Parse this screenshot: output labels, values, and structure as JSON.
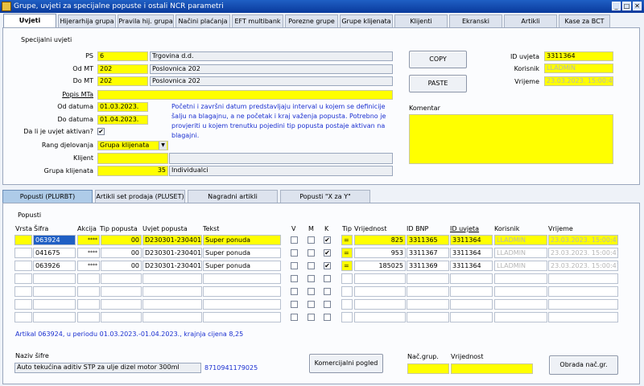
{
  "window": {
    "title": "Grupe, uvjeti za specijalne popuste i ostali NCR parametri"
  },
  "tabs": [
    "Uvjeti",
    "Hijerarhija grupa",
    "Pravila hij. grupa",
    "Načini plaćanja",
    "EFT multibank",
    "Porezne grupe",
    "Grupe klijenata",
    "Klijenti",
    "Ekranski",
    "Artikli",
    "Kase za BCT"
  ],
  "special": {
    "section_title": "Specijalni uvjeti",
    "ps_label": "PS",
    "ps_code": "6",
    "ps_name": "Trgovina d.d.",
    "odmt_label": "Od MT",
    "odmt_code": "202",
    "odmt_name": "Poslovnica 202",
    "domt_label": "Do MT",
    "domt_code": "202",
    "domt_name": "Poslovnica 202",
    "popis_label": "Popis MTa",
    "popis_value": "",
    "od_datuma_label": "Od datuma",
    "od_datuma": "01.03.2023.",
    "do_datuma_label": "Do datuma",
    "do_datuma": "01.04.2023.",
    "note": "Početni i završni datum predstavljaju interval u kojem se definicije šalju na blagajnu, a ne početak i kraj važenja popusta. Potrebno je provjeriti u kojem trenutku pojedini tip popusta postaje aktivan na blagajni.",
    "active_label": "Da li je uvjet aktivan?",
    "active_checked": "✔",
    "rang_label": "Rang djelovanja",
    "rang_value": "Grupa klijenata",
    "klijent_label": "Klijent",
    "klijent_value": "",
    "grupa_label": "Grupa klijenata",
    "grupa_code": "35",
    "grupa_name": "Individualci",
    "copy_label": "COPY",
    "paste_label": "PASTE",
    "id_uvjeta_label": "ID uvjeta",
    "id_uvjeta": "3311364",
    "korisnik_label": "Korisnik",
    "korisnik": "LLADMIN",
    "vrijeme_label": "Vrijeme",
    "vrijeme": "23.03.2023. 15:00:41",
    "komentar_label": "Komentar",
    "komentar": ""
  },
  "lower_tabs": [
    "Popusti (PLURBT)",
    "Artikli set prodaja (PLUSET)",
    "Nagradni artikli",
    "Popusti \"X za Y\""
  ],
  "popusti": {
    "section_title": "Popusti",
    "columns": [
      "Vrsta",
      "Šifra",
      "Akcija",
      "Tip popusta",
      "Uvjet popusta",
      "Tekst",
      "V",
      "M",
      "K",
      "Tip",
      "Vrijednost",
      "ID BNP",
      "ID uvjeta",
      "Korisnik",
      "Vrijeme"
    ],
    "rows": [
      {
        "sifra": "063924",
        "akcija": "****",
        "tip": "00",
        "uvjet": "D230301-230401",
        "tekst": "Super ponuda",
        "v": "",
        "m": "",
        "k": "✔",
        "tip2": "=",
        "vrijednost": "825",
        "bnp": "3311365",
        "id": "3311364",
        "korisnik": "LLADMIN",
        "vrijeme": "23.03.2023. 15:00:41"
      },
      {
        "sifra": "041675",
        "akcija": "****",
        "tip": "00",
        "uvjet": "D230301-230401",
        "tekst": "Super ponuda",
        "v": "",
        "m": "",
        "k": "✔",
        "tip2": "=",
        "vrijednost": "953",
        "bnp": "3311367",
        "id": "3311364",
        "korisnik": "LLADMIN",
        "vrijeme": "23.03.2023. 15:00:41"
      },
      {
        "sifra": "063926",
        "akcija": "****",
        "tip": "00",
        "uvjet": "D230301-230401",
        "tekst": "Super ponuda",
        "v": "",
        "m": "",
        "k": "✔",
        "tip2": "=",
        "vrijednost": "185025",
        "bnp": "3311369",
        "id": "3311364",
        "korisnik": "LLADMIN",
        "vrijeme": "23.03.2023. 15:00:41"
      }
    ],
    "info": "Artikal 063924, u periodu 01.03.2023.-01.04.2023., krajnja cijena 8,25",
    "naziv_label": "Naziv šifre",
    "naziv": "Auto tekućina aditiv STP za ulje dizel motor 300ml",
    "barcode": "8710941179025",
    "komercijalni_label": "Komercijalni pogled",
    "nac_grup_label": "Nač.grup.",
    "vrijednost_label": "Vrijednost",
    "obrada_label": "Obrada nač.gr."
  }
}
